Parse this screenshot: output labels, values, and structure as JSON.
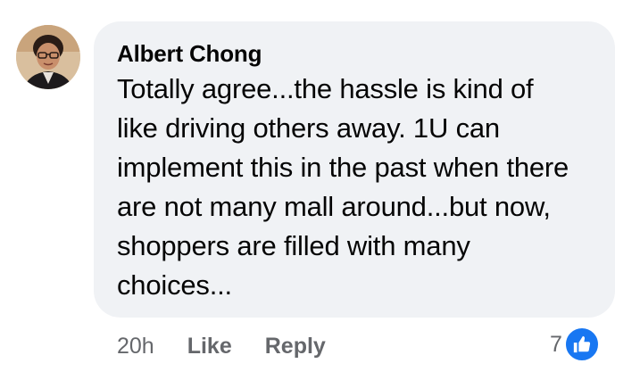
{
  "comment": {
    "author": "Albert Chong",
    "text": "Totally agree...the hassle is kind of like driving others away. 1U can implement this in the past when there are not many mall around...but now, shoppers are filled with many choices...",
    "avatar_icon": "profile-photo"
  },
  "actions": {
    "time": "20h",
    "like_label": "Like",
    "reply_label": "Reply"
  },
  "reactions": {
    "count": "7",
    "icon": "thumbs-up-icon",
    "badge_color": "#1877f2"
  },
  "colors": {
    "bubble_bg": "#f0f2f5",
    "secondary_text": "#65676b"
  }
}
